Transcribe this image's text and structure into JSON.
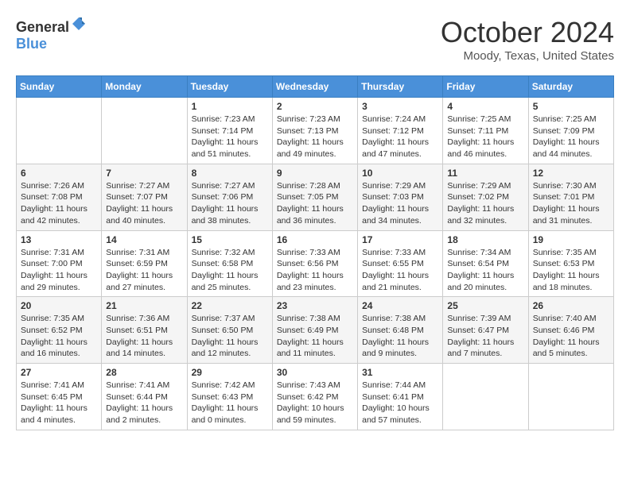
{
  "header": {
    "logo": {
      "text_general": "General",
      "text_blue": "Blue"
    },
    "title": "October 2024",
    "location": "Moody, Texas, United States"
  },
  "days_of_week": [
    "Sunday",
    "Monday",
    "Tuesday",
    "Wednesday",
    "Thursday",
    "Friday",
    "Saturday"
  ],
  "weeks": [
    [
      {
        "day": "",
        "info": ""
      },
      {
        "day": "",
        "info": ""
      },
      {
        "day": "1",
        "info": "Sunrise: 7:23 AM\nSunset: 7:14 PM\nDaylight: 11 hours and 51 minutes."
      },
      {
        "day": "2",
        "info": "Sunrise: 7:23 AM\nSunset: 7:13 PM\nDaylight: 11 hours and 49 minutes."
      },
      {
        "day": "3",
        "info": "Sunrise: 7:24 AM\nSunset: 7:12 PM\nDaylight: 11 hours and 47 minutes."
      },
      {
        "day": "4",
        "info": "Sunrise: 7:25 AM\nSunset: 7:11 PM\nDaylight: 11 hours and 46 minutes."
      },
      {
        "day": "5",
        "info": "Sunrise: 7:25 AM\nSunset: 7:09 PM\nDaylight: 11 hours and 44 minutes."
      }
    ],
    [
      {
        "day": "6",
        "info": "Sunrise: 7:26 AM\nSunset: 7:08 PM\nDaylight: 11 hours and 42 minutes."
      },
      {
        "day": "7",
        "info": "Sunrise: 7:27 AM\nSunset: 7:07 PM\nDaylight: 11 hours and 40 minutes."
      },
      {
        "day": "8",
        "info": "Sunrise: 7:27 AM\nSunset: 7:06 PM\nDaylight: 11 hours and 38 minutes."
      },
      {
        "day": "9",
        "info": "Sunrise: 7:28 AM\nSunset: 7:05 PM\nDaylight: 11 hours and 36 minutes."
      },
      {
        "day": "10",
        "info": "Sunrise: 7:29 AM\nSunset: 7:03 PM\nDaylight: 11 hours and 34 minutes."
      },
      {
        "day": "11",
        "info": "Sunrise: 7:29 AM\nSunset: 7:02 PM\nDaylight: 11 hours and 32 minutes."
      },
      {
        "day": "12",
        "info": "Sunrise: 7:30 AM\nSunset: 7:01 PM\nDaylight: 11 hours and 31 minutes."
      }
    ],
    [
      {
        "day": "13",
        "info": "Sunrise: 7:31 AM\nSunset: 7:00 PM\nDaylight: 11 hours and 29 minutes."
      },
      {
        "day": "14",
        "info": "Sunrise: 7:31 AM\nSunset: 6:59 PM\nDaylight: 11 hours and 27 minutes."
      },
      {
        "day": "15",
        "info": "Sunrise: 7:32 AM\nSunset: 6:58 PM\nDaylight: 11 hours and 25 minutes."
      },
      {
        "day": "16",
        "info": "Sunrise: 7:33 AM\nSunset: 6:56 PM\nDaylight: 11 hours and 23 minutes."
      },
      {
        "day": "17",
        "info": "Sunrise: 7:33 AM\nSunset: 6:55 PM\nDaylight: 11 hours and 21 minutes."
      },
      {
        "day": "18",
        "info": "Sunrise: 7:34 AM\nSunset: 6:54 PM\nDaylight: 11 hours and 20 minutes."
      },
      {
        "day": "19",
        "info": "Sunrise: 7:35 AM\nSunset: 6:53 PM\nDaylight: 11 hours and 18 minutes."
      }
    ],
    [
      {
        "day": "20",
        "info": "Sunrise: 7:35 AM\nSunset: 6:52 PM\nDaylight: 11 hours and 16 minutes."
      },
      {
        "day": "21",
        "info": "Sunrise: 7:36 AM\nSunset: 6:51 PM\nDaylight: 11 hours and 14 minutes."
      },
      {
        "day": "22",
        "info": "Sunrise: 7:37 AM\nSunset: 6:50 PM\nDaylight: 11 hours and 12 minutes."
      },
      {
        "day": "23",
        "info": "Sunrise: 7:38 AM\nSunset: 6:49 PM\nDaylight: 11 hours and 11 minutes."
      },
      {
        "day": "24",
        "info": "Sunrise: 7:38 AM\nSunset: 6:48 PM\nDaylight: 11 hours and 9 minutes."
      },
      {
        "day": "25",
        "info": "Sunrise: 7:39 AM\nSunset: 6:47 PM\nDaylight: 11 hours and 7 minutes."
      },
      {
        "day": "26",
        "info": "Sunrise: 7:40 AM\nSunset: 6:46 PM\nDaylight: 11 hours and 5 minutes."
      }
    ],
    [
      {
        "day": "27",
        "info": "Sunrise: 7:41 AM\nSunset: 6:45 PM\nDaylight: 11 hours and 4 minutes."
      },
      {
        "day": "28",
        "info": "Sunrise: 7:41 AM\nSunset: 6:44 PM\nDaylight: 11 hours and 2 minutes."
      },
      {
        "day": "29",
        "info": "Sunrise: 7:42 AM\nSunset: 6:43 PM\nDaylight: 11 hours and 0 minutes."
      },
      {
        "day": "30",
        "info": "Sunrise: 7:43 AM\nSunset: 6:42 PM\nDaylight: 10 hours and 59 minutes."
      },
      {
        "day": "31",
        "info": "Sunrise: 7:44 AM\nSunset: 6:41 PM\nDaylight: 10 hours and 57 minutes."
      },
      {
        "day": "",
        "info": ""
      },
      {
        "day": "",
        "info": ""
      }
    ]
  ]
}
